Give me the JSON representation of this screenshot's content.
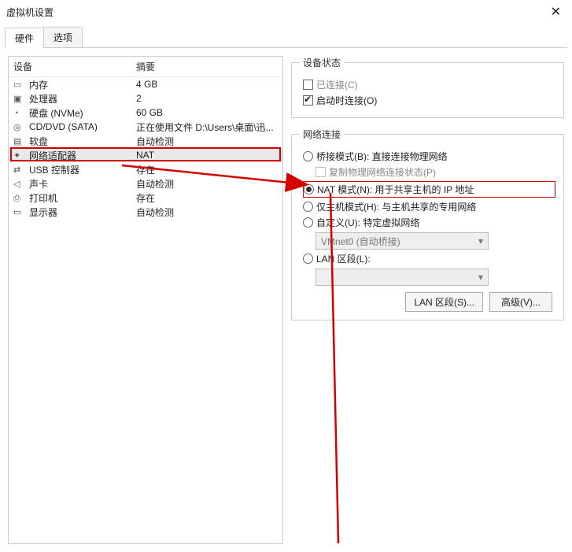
{
  "window": {
    "title": "虚拟机设置"
  },
  "tabs": {
    "hardware": "硬件",
    "options": "选项"
  },
  "leftHeaders": {
    "device": "设备",
    "summary": "摘要"
  },
  "devices": [
    {
      "icon": "ic-mem",
      "dname": "device-icon-memory",
      "name": "内存",
      "summary": "4 GB"
    },
    {
      "icon": "ic-cpu",
      "dname": "device-icon-cpu",
      "name": "处理器",
      "summary": "2"
    },
    {
      "icon": "ic-disk",
      "dname": "device-icon-disk",
      "name": "硬盘 (NVMe)",
      "summary": "60 GB"
    },
    {
      "icon": "ic-cd",
      "dname": "device-icon-cd",
      "name": "CD/DVD (SATA)",
      "summary": "正在使用文件 D:\\Users\\桌面\\迅..."
    },
    {
      "icon": "ic-floppy",
      "dname": "device-icon-floppy",
      "name": "软盘",
      "summary": "自动检测"
    },
    {
      "icon": "ic-net",
      "dname": "device-icon-network",
      "name": "网络适配器",
      "summary": "NAT",
      "selected": true
    },
    {
      "icon": "ic-usb",
      "dname": "device-icon-usb",
      "name": "USB 控制器",
      "summary": "存在"
    },
    {
      "icon": "ic-sound",
      "dname": "device-icon-sound",
      "name": "声卡",
      "summary": "自动检测"
    },
    {
      "icon": "ic-print",
      "dname": "device-icon-printer",
      "name": "打印机",
      "summary": "存在"
    },
    {
      "icon": "ic-disp",
      "dname": "device-icon-display",
      "name": "显示器",
      "summary": "自动检测"
    }
  ],
  "status": {
    "legend": "设备状态",
    "connected": "已连接(C)",
    "connectOnStart": "启动时连接(O)"
  },
  "net": {
    "legend": "网络连接",
    "bridged": "桥接模式(B): 直接连接物理网络",
    "replicate": "复制物理网络连接状态(P)",
    "nat": "NAT 模式(N): 用于共享主机的 IP 地址",
    "hostonly": "仅主机模式(H): 与主机共享的专用网络",
    "custom": "自定义(U): 特定虚拟网络",
    "customCombo": "VMnet0 (自动桥接)",
    "lan": "LAN 区段(L):",
    "lanBtn": "LAN 区段(S)...",
    "advBtn": "高级(V)..."
  }
}
